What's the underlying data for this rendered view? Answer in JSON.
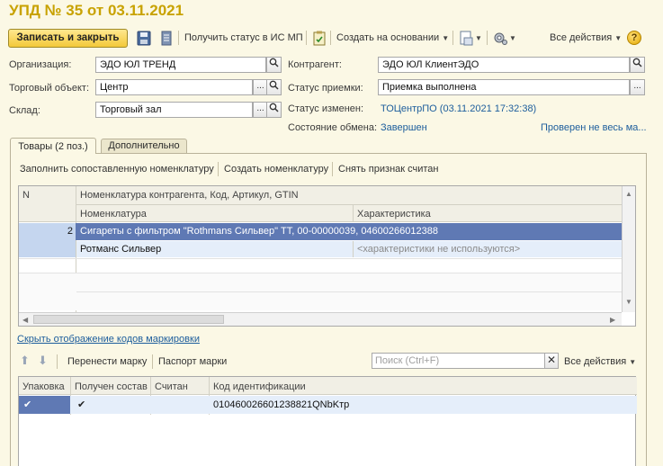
{
  "window": {
    "title": "УПД № 35 от 03.11.2021"
  },
  "toolbar": {
    "save_close": "Записать и закрыть",
    "get_status": "Получить статус в ИС МП",
    "create_based": "Создать на основании",
    "all_actions": "Все действия",
    "help": "?"
  },
  "form": {
    "organization_label": "Организация:",
    "organization_value": "ЭДО ЮЛ ТРЕНД",
    "trade_object_label": "Торговый объект:",
    "trade_object_value": "Центр",
    "warehouse_label": "Склад:",
    "warehouse_value": "Торговый зал",
    "counterparty_label": "Контрагент:",
    "counterparty_value": "ЭДО ЮЛ КлиентЭДО",
    "acceptance_label": "Статус приемки:",
    "acceptance_value": "Приемка выполнена",
    "status_changed_label": "Статус изменен:",
    "status_changed_value": "ТОЦентрПО (03.11.2021 17:32:38)",
    "exchange_label": "Состояние обмена:",
    "exchange_value": "Завершен",
    "checked_link": "Проверен не весь ма..."
  },
  "tabs": [
    {
      "label": "Товары (2 поз.)",
      "active": true
    },
    {
      "label": "Дополнительно",
      "active": false
    }
  ],
  "goods": {
    "commands": [
      "Заполнить сопоставленную номенклатуру",
      "Создать номенклатуру",
      "Снять признак считан"
    ],
    "col_n": "N",
    "col_counterparty_nom": "Номенклатура контрагента, Код, Артикул, GTIN",
    "col_nom": "Номенклатура",
    "col_char": "Характеристика",
    "rows": [
      {
        "n": "2",
        "counterparty_nom": "Сигареты с фильтром \"Rothmans Сильвер\" ТТ, 00-00000039, 04600266012388",
        "nom": "Ротманс Сильвер",
        "char": "<характеристики не используются>"
      }
    ]
  },
  "marking": {
    "hide_link": "Скрыть отображение кодов маркировки",
    "move_mark": "Перенести марку",
    "mark_passport": "Паспорт марки",
    "search_placeholder": "Поиск (Ctrl+F)",
    "all_actions": "Все действия",
    "cols": [
      "Упаковка",
      "Получен состав",
      "Считан",
      "Код идентификации"
    ],
    "rows": [
      {
        "packaging": "✔",
        "composition": "✔",
        "scanned": "",
        "code": "010460026601238821QNbKтp"
      }
    ]
  },
  "colors": {
    "title": "#c8a200",
    "link": "#1c5d9c",
    "selection": "#5f79b4",
    "background": "#fbf8e5"
  }
}
